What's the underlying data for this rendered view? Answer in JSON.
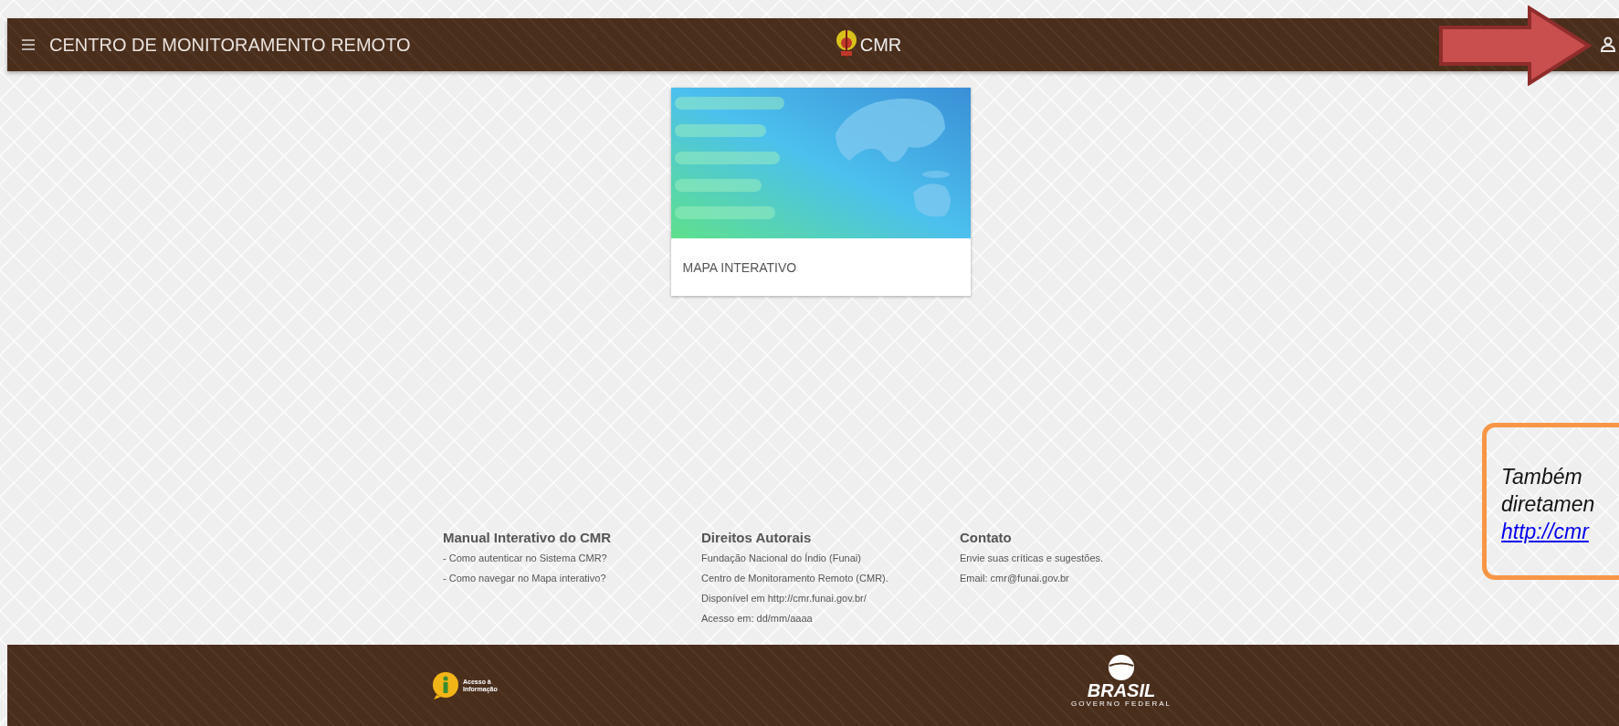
{
  "header": {
    "title": "CENTRO DE MONITORAMENTO REMOTO",
    "logo_text": "CMR"
  },
  "cards": [
    {
      "kind": "picture",
      "title": "MAPA INTERATIVO"
    }
  ],
  "footer_columns": [
    {
      "heading": "Manual Interativo do CMR",
      "lines": [
        "- Como autenticar no Sistema CMR?",
        "- Como navegar no Mapa interativo?"
      ]
    },
    {
      "heading": "Direitos Autorais",
      "lines": [
        "Fundação Nacional do Índio (Funai)",
        "Centro de Monitoramento Remoto (CMR).",
        "Disponível em http://cmr.funai.gov.br/",
        "Acesso em: dd/mm/aaaa"
      ]
    },
    {
      "heading": "Contato",
      "lines": [
        "Envie suas críticas e sugestões.",
        "Email: cmr@funai.gov.br"
      ]
    }
  ],
  "bottom_bar": {
    "access_logo_text": [
      "Acesso à",
      "Informação"
    ],
    "brasil_logo_text": "BRASIL",
    "brasil_logo_subtext": "GOVERNO FEDERAL"
  },
  "callout": {
    "lines": [
      "Também",
      "diretamen"
    ],
    "link": "http://cmr"
  }
}
